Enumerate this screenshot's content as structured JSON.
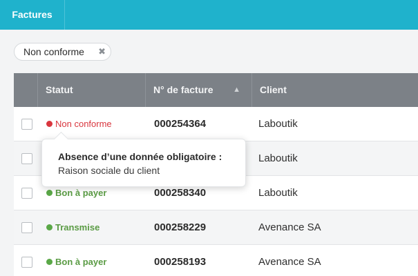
{
  "topbar": {
    "tab_label": "Factures"
  },
  "filter_chip": {
    "label": "Non conforme",
    "close_glyph": "✖"
  },
  "table": {
    "headers": {
      "status": "Statut",
      "invoice_number": "N° de facture",
      "client": "Client",
      "sort_icon_glyph": "▲"
    },
    "rows": [
      {
        "status": "Non conforme",
        "status_color": "#d9363e",
        "invoice": "000254364",
        "client": "Laboutik"
      },
      {
        "status": "",
        "invoice": "",
        "client": "Laboutik"
      },
      {
        "status": "Bon à payer",
        "status_color": "#5aa847",
        "invoice": "000258340",
        "client": "Laboutik"
      },
      {
        "status": "Transmise",
        "status_color": "#5aa847",
        "invoice": "000258229",
        "client": "Avenance SA"
      },
      {
        "status": "Bon à payer",
        "status_color": "#5aa847",
        "invoice": "000258193",
        "client": "Avenance SA"
      }
    ]
  },
  "tooltip": {
    "title": "Absence d’une donnée obligatoire :",
    "body": "Raison sociale du client"
  },
  "colors": {
    "accent": "#1fb2cc",
    "header": "#7c8187",
    "error": "#d9363e",
    "ok": "#5aa847"
  },
  "icons": {
    "chip_close": "close-icon",
    "sort": "sort-asc-icon"
  }
}
